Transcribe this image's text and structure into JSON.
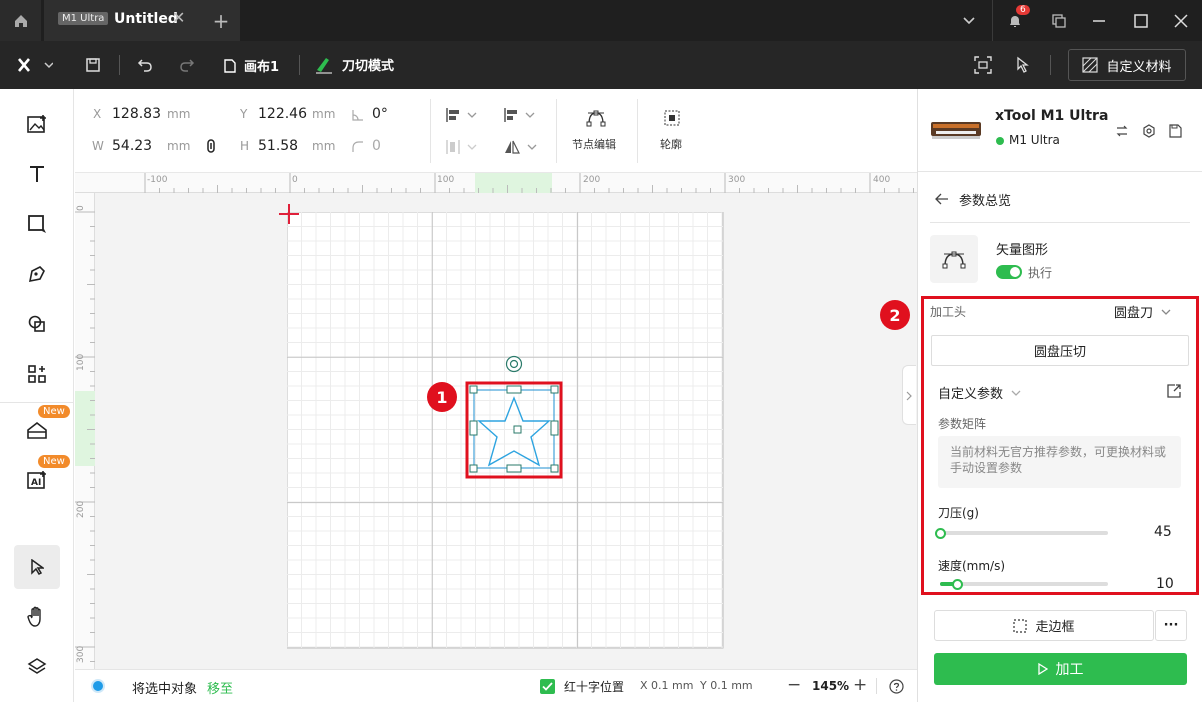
{
  "titlebar": {
    "home_icon": "home-icon",
    "tab_badge": "M1 Ultra",
    "tab_title": "Untitled",
    "notification_count": "6"
  },
  "toolbar": {
    "canvas_label": "画布1",
    "mode_label": "刀切模式",
    "custom_material_label": "自定义材料"
  },
  "left_sidebar": {
    "new_badge_1": "New",
    "new_badge_2": "New"
  },
  "props": {
    "x_label": "X",
    "x_value": "128.83",
    "x_unit": "mm",
    "y_label": "Y",
    "y_value": "122.46",
    "y_unit": "mm",
    "w_label": "W",
    "w_value": "54.23",
    "w_unit": "mm",
    "h_label": "H",
    "h_value": "51.58",
    "h_unit": "mm",
    "angle_value": "0°",
    "radius_value": "0",
    "node_edit_label": "节点编辑",
    "outline_label": "轮廓"
  },
  "ruler": {
    "h_ticks": [
      "-100",
      "0",
      "100",
      "200",
      "300",
      "400"
    ],
    "v_ticks": [
      "0",
      "100",
      "200",
      "300"
    ]
  },
  "statusbar": {
    "move_selected_label": "将选中对象",
    "move_to_link": "移至",
    "red_cross_label": "红十字位置",
    "x_pos": "X 0.1 mm",
    "y_pos": "Y 0.1 mm",
    "zoom": "145%"
  },
  "annotations": {
    "marker_1": "1",
    "marker_2": "2"
  },
  "device": {
    "name": "xTool M1 Ultra",
    "status": "M1 Ultra",
    "status_color": "#2ebc4f"
  },
  "panel": {
    "back_label": "参数总览",
    "vector_label": "矢量图形",
    "execute_label": "执行",
    "head_label": "加工头",
    "head_value": "圆盘刀",
    "process_button": "圆盘压切",
    "custom_params_label": "自定义参数",
    "matrix_label": "参数矩阵",
    "matrix_note": "当前材料无官方推荐参数，可更换材料或手动设置参数",
    "pressure_label": "刀压(g)",
    "pressure_value": "45",
    "speed_label": "速度(mm/s)",
    "speed_value": "10",
    "frame_button": "走边框",
    "process_action": "加工",
    "accent_color": "#2ebc4f",
    "pressure_level": 0,
    "speed_level": 0.1
  }
}
